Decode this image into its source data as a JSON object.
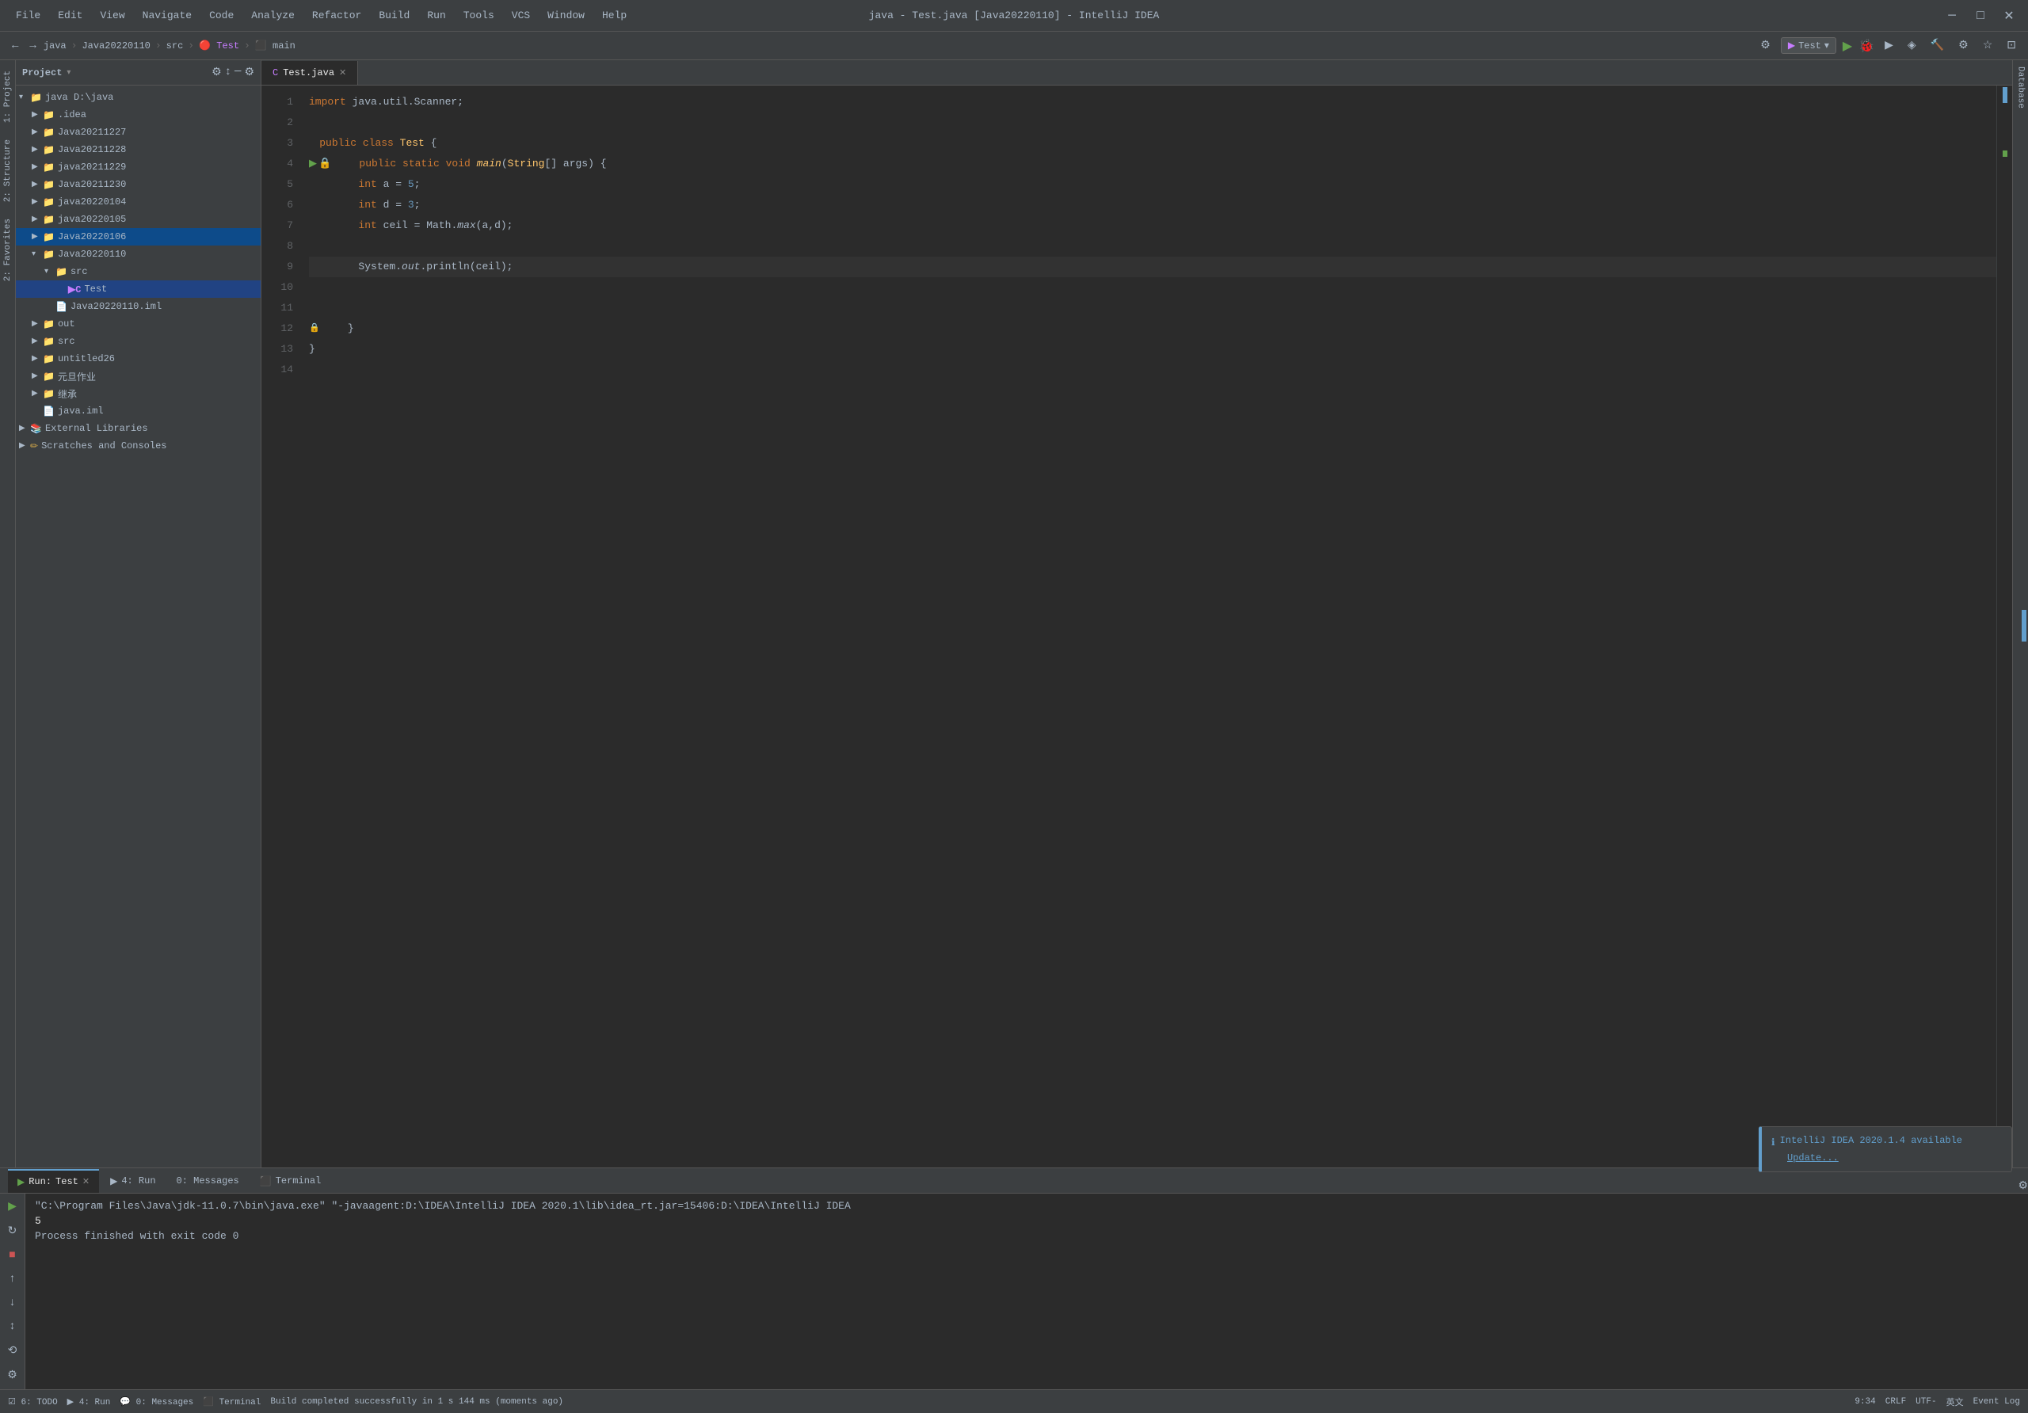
{
  "titlebar": {
    "title": "java - Test.java [Java20220110] - IntelliJ IDEA",
    "menus": [
      "File",
      "Edit",
      "View",
      "Navigate",
      "Code",
      "Analyze",
      "Refactor",
      "Build",
      "Run",
      "Tools",
      "VCS",
      "Window",
      "Help"
    ],
    "window_controls": [
      "─",
      "□",
      "✕"
    ]
  },
  "navbar": {
    "breadcrumb": [
      "java",
      "Java20220110",
      "src",
      "Test",
      "main"
    ],
    "run_config": "Test",
    "icons": [
      "←",
      "→",
      "gear",
      "run",
      "debug",
      "coverage",
      "profile",
      "build",
      "settings"
    ]
  },
  "project_panel": {
    "title": "Project",
    "header_icons": [
      "cog",
      "sort",
      "minus",
      "settings"
    ],
    "tree": [
      {
        "label": "java D:\\java",
        "level": 0,
        "expanded": true,
        "type": "folder",
        "icon": "📁"
      },
      {
        "label": ".idea",
        "level": 1,
        "expanded": false,
        "type": "folder",
        "icon": "📁"
      },
      {
        "label": "Java20211227",
        "level": 1,
        "expanded": false,
        "type": "folder",
        "icon": "📁"
      },
      {
        "label": "Java20211228",
        "level": 1,
        "expanded": false,
        "type": "folder",
        "icon": "📁"
      },
      {
        "label": "java20211229",
        "level": 1,
        "expanded": false,
        "type": "folder",
        "icon": "📁"
      },
      {
        "label": "Java20211230",
        "level": 1,
        "expanded": false,
        "type": "folder",
        "icon": "📁"
      },
      {
        "label": "java20220104",
        "level": 1,
        "expanded": false,
        "type": "folder",
        "icon": "📁"
      },
      {
        "label": "java20220105",
        "level": 1,
        "expanded": false,
        "type": "folder",
        "icon": "📁"
      },
      {
        "label": "Java20220106",
        "level": 1,
        "expanded": false,
        "type": "folder",
        "icon": "📁",
        "selected": true
      },
      {
        "label": "Java20220110",
        "level": 1,
        "expanded": true,
        "type": "folder",
        "icon": "📁"
      },
      {
        "label": "src",
        "level": 2,
        "expanded": true,
        "type": "src",
        "icon": "📁"
      },
      {
        "label": "Test",
        "level": 3,
        "expanded": false,
        "type": "java",
        "icon": "C"
      },
      {
        "label": "Java20220110.iml",
        "level": 2,
        "expanded": false,
        "type": "iml",
        "icon": "📄"
      },
      {
        "label": "out",
        "level": 1,
        "expanded": false,
        "type": "folder",
        "icon": "📁"
      },
      {
        "label": "src",
        "level": 1,
        "expanded": false,
        "type": "folder",
        "icon": "📁"
      },
      {
        "label": "untitled26",
        "level": 1,
        "expanded": false,
        "type": "folder",
        "icon": "📁"
      },
      {
        "label": "元旦作业",
        "level": 1,
        "expanded": false,
        "type": "folder",
        "icon": "📁"
      },
      {
        "label": "继承",
        "level": 1,
        "expanded": false,
        "type": "folder",
        "icon": "📁"
      },
      {
        "label": "java.iml",
        "level": 1,
        "expanded": false,
        "type": "iml",
        "icon": "📄"
      },
      {
        "label": "External Libraries",
        "level": 0,
        "expanded": false,
        "type": "library",
        "icon": "📚"
      },
      {
        "label": "Scratches and Consoles",
        "level": 0,
        "expanded": false,
        "type": "folder",
        "icon": "📁"
      }
    ]
  },
  "editor": {
    "tab_name": "Test.java",
    "tab_icon": "C",
    "lines": [
      {
        "num": 1,
        "code": "import java.util.Scanner;",
        "tokens": [
          {
            "text": "import ",
            "cls": "kw"
          },
          {
            "text": "java.util.Scanner",
            "cls": "plain"
          },
          {
            "text": ";",
            "cls": "plain"
          }
        ]
      },
      {
        "num": 2,
        "code": "",
        "tokens": []
      },
      {
        "num": 3,
        "code": "public class Test {",
        "has_run_arrow": true,
        "tokens": [
          {
            "text": "public ",
            "cls": "kw"
          },
          {
            "text": "class ",
            "cls": "kw"
          },
          {
            "text": "Test",
            "cls": "class-name"
          },
          {
            "text": " {",
            "cls": "plain"
          }
        ]
      },
      {
        "num": 4,
        "code": "    public static void main(String[] args) {",
        "has_run_arrow": true,
        "has_lock": true,
        "tokens": [
          {
            "text": "    public ",
            "cls": "kw"
          },
          {
            "text": "static ",
            "cls": "kw"
          },
          {
            "text": "void ",
            "cls": "kw"
          },
          {
            "text": "main",
            "cls": "method"
          },
          {
            "text": "(",
            "cls": "plain"
          },
          {
            "text": "String",
            "cls": "class-name"
          },
          {
            "text": "[] args) {",
            "cls": "plain"
          }
        ]
      },
      {
        "num": 5,
        "code": "        int a = 5;",
        "tokens": [
          {
            "text": "        ",
            "cls": "plain"
          },
          {
            "text": "int ",
            "cls": "type"
          },
          {
            "text": "a = ",
            "cls": "plain"
          },
          {
            "text": "5",
            "cls": "number"
          },
          {
            "text": ";",
            "cls": "plain"
          }
        ]
      },
      {
        "num": 6,
        "code": "        int d = 3;",
        "tokens": [
          {
            "text": "        ",
            "cls": "plain"
          },
          {
            "text": "int ",
            "cls": "type"
          },
          {
            "text": "d = ",
            "cls": "plain"
          },
          {
            "text": "3",
            "cls": "number"
          },
          {
            "text": ";",
            "cls": "plain"
          }
        ]
      },
      {
        "num": 7,
        "code": "        int ceil = Math.max(a,d);",
        "tokens": [
          {
            "text": "        ",
            "cls": "plain"
          },
          {
            "text": "int ",
            "cls": "type"
          },
          {
            "text": "ceil = Math.",
            "cls": "plain"
          },
          {
            "text": "max",
            "cls": "italic"
          },
          {
            "text": "(a,d);",
            "cls": "plain"
          }
        ]
      },
      {
        "num": 8,
        "code": "",
        "tokens": []
      },
      {
        "num": 9,
        "code": "        System.out.println(ceil);",
        "highlighted": true,
        "tokens": [
          {
            "text": "        ",
            "cls": "plain"
          },
          {
            "text": "System",
            "cls": "plain"
          },
          {
            "text": ".",
            "cls": "plain"
          },
          {
            "text": "out",
            "cls": "sys-out"
          },
          {
            "text": ".println(ceil);",
            "cls": "plain"
          }
        ]
      },
      {
        "num": 10,
        "code": "",
        "tokens": []
      },
      {
        "num": 11,
        "code": "",
        "tokens": []
      },
      {
        "num": 12,
        "code": "    }",
        "has_lock": true,
        "tokens": [
          {
            "text": "    }",
            "cls": "plain"
          }
        ]
      },
      {
        "num": 13,
        "code": "}",
        "tokens": [
          {
            "text": "}",
            "cls": "plain"
          }
        ]
      },
      {
        "num": 14,
        "code": "",
        "tokens": []
      }
    ]
  },
  "run_panel": {
    "tab_name": "Run",
    "config_name": "Test",
    "command": "\"C:\\Program Files\\Java\\jdk-11.0.7\\bin\\java.exe\" \"-javaagent:D:\\IDEA\\IntelliJ IDEA 2020.1\\lib\\idea_rt.jar=15406:D:\\IDEA\\IntelliJ IDEA",
    "output": "5",
    "process_result": "Process finished with exit code 0"
  },
  "bottom_tabs": [
    "Run",
    "4: Run",
    "0: Messages",
    "Terminal"
  ],
  "status_bar": {
    "build_status": "Build completed successfully in 1 s 144 ms (moments ago)",
    "todo": "6: TODO",
    "run": "4: Run",
    "messages": "0: Messages",
    "terminal": "Terminal",
    "line_col": "9:34",
    "crlf": "CRLF",
    "encoding": "UTF-",
    "locale": "英文"
  },
  "notification": {
    "icon": "ℹ",
    "title": "IntelliJ IDEA 2020.1.4 available",
    "link": "Update..."
  },
  "sidebar_left": {
    "items": [
      "1: Project",
      "2: Structure",
      "2: Favorites"
    ]
  },
  "sidebar_right": {
    "items": [
      "Database"
    ]
  }
}
